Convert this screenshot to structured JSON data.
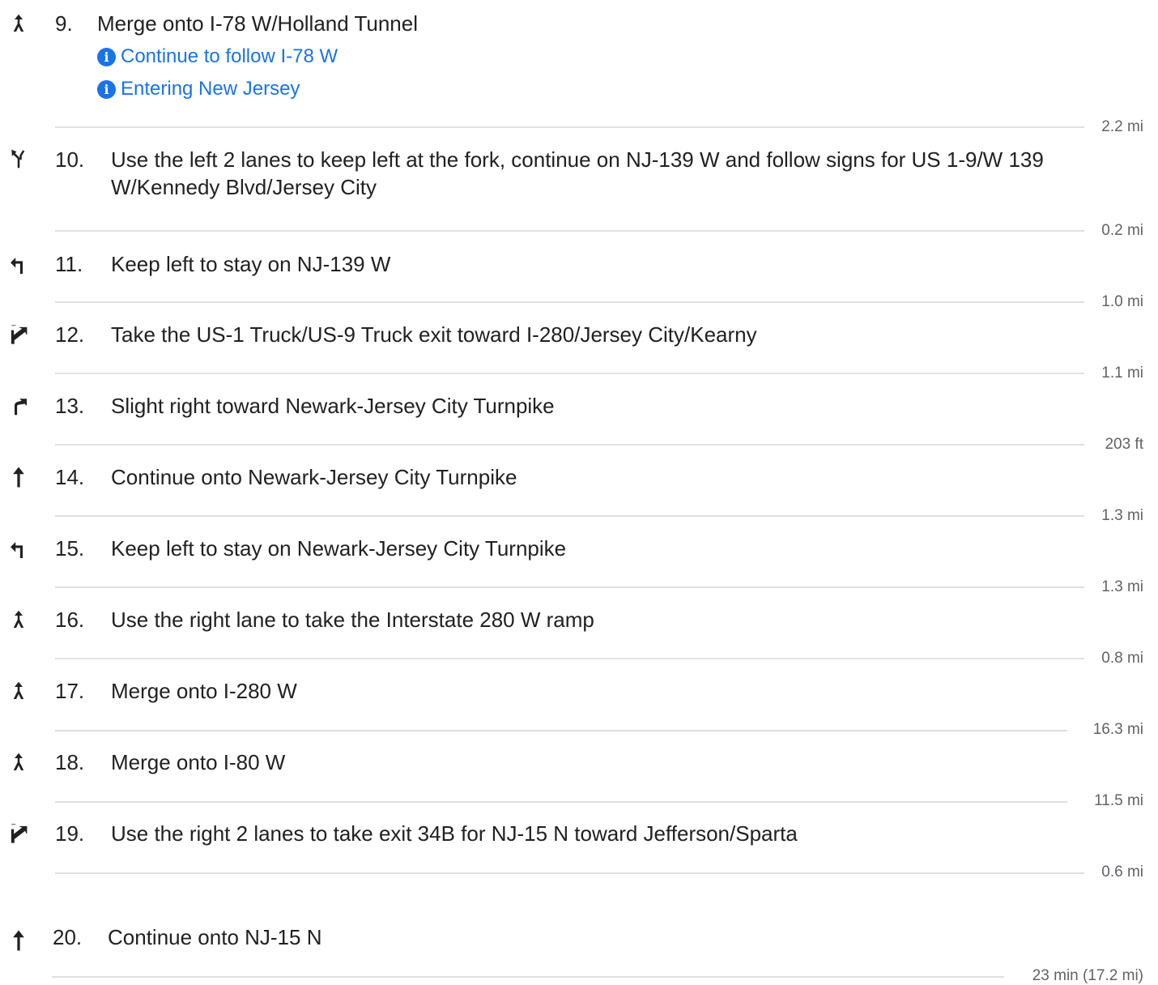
{
  "steps": [
    {
      "number": "9.",
      "icon": "merge-icon",
      "text": "Merge onto I-78 W/Holland Tunnel",
      "notes": [
        "Continue to follow I-78 W",
        "Entering New Jersey"
      ],
      "distance": "2.2 mi"
    },
    {
      "number": "10.",
      "icon": "fork-left-icon",
      "text": "Use the left 2 lanes to keep left at the fork, continue on NJ-139 W and follow signs for US 1-9/W 139 W/Kennedy Blvd/Jersey City",
      "distance": "0.2 mi"
    },
    {
      "number": "11.",
      "icon": "keep-left-icon",
      "text": "Keep left to stay on NJ-139 W",
      "distance": "1.0 mi"
    },
    {
      "number": "12.",
      "icon": "ramp-right-icon",
      "text": "Take the US-1 Truck/US-9 Truck exit toward I-280/Jersey City/Kearny",
      "distance": "1.1 mi"
    },
    {
      "number": "13.",
      "icon": "slight-right-icon",
      "text": "Slight right toward Newark-Jersey City Turnpike",
      "distance": "203 ft"
    },
    {
      "number": "14.",
      "icon": "straight-icon",
      "text": "Continue onto Newark-Jersey City Turnpike",
      "distance": "1.3 mi"
    },
    {
      "number": "15.",
      "icon": "keep-left-icon",
      "text": "Keep left to stay on Newark-Jersey City Turnpike",
      "distance": "1.3 mi"
    },
    {
      "number": "16.",
      "icon": "merge-icon",
      "text": "Use the right lane to take the Interstate 280 W ramp",
      "distance": "0.8 mi"
    },
    {
      "number": "17.",
      "icon": "merge-icon",
      "text": "Merge onto I-280 W",
      "distance": "16.3 mi"
    },
    {
      "number": "18.",
      "icon": "merge-icon",
      "text": "Merge onto I-80 W",
      "distance": "11.5 mi"
    },
    {
      "number": "19.",
      "icon": "ramp-right-icon",
      "text": "Use the right 2 lanes to take exit 34B for NJ-15 N toward Jefferson/Sparta",
      "distance": "0.6 mi"
    },
    {
      "number": "20.",
      "icon": "straight-icon",
      "text": "Continue onto NJ-15 N",
      "distance": "23 min (17.2 mi)"
    }
  ],
  "info_glyph": "i"
}
